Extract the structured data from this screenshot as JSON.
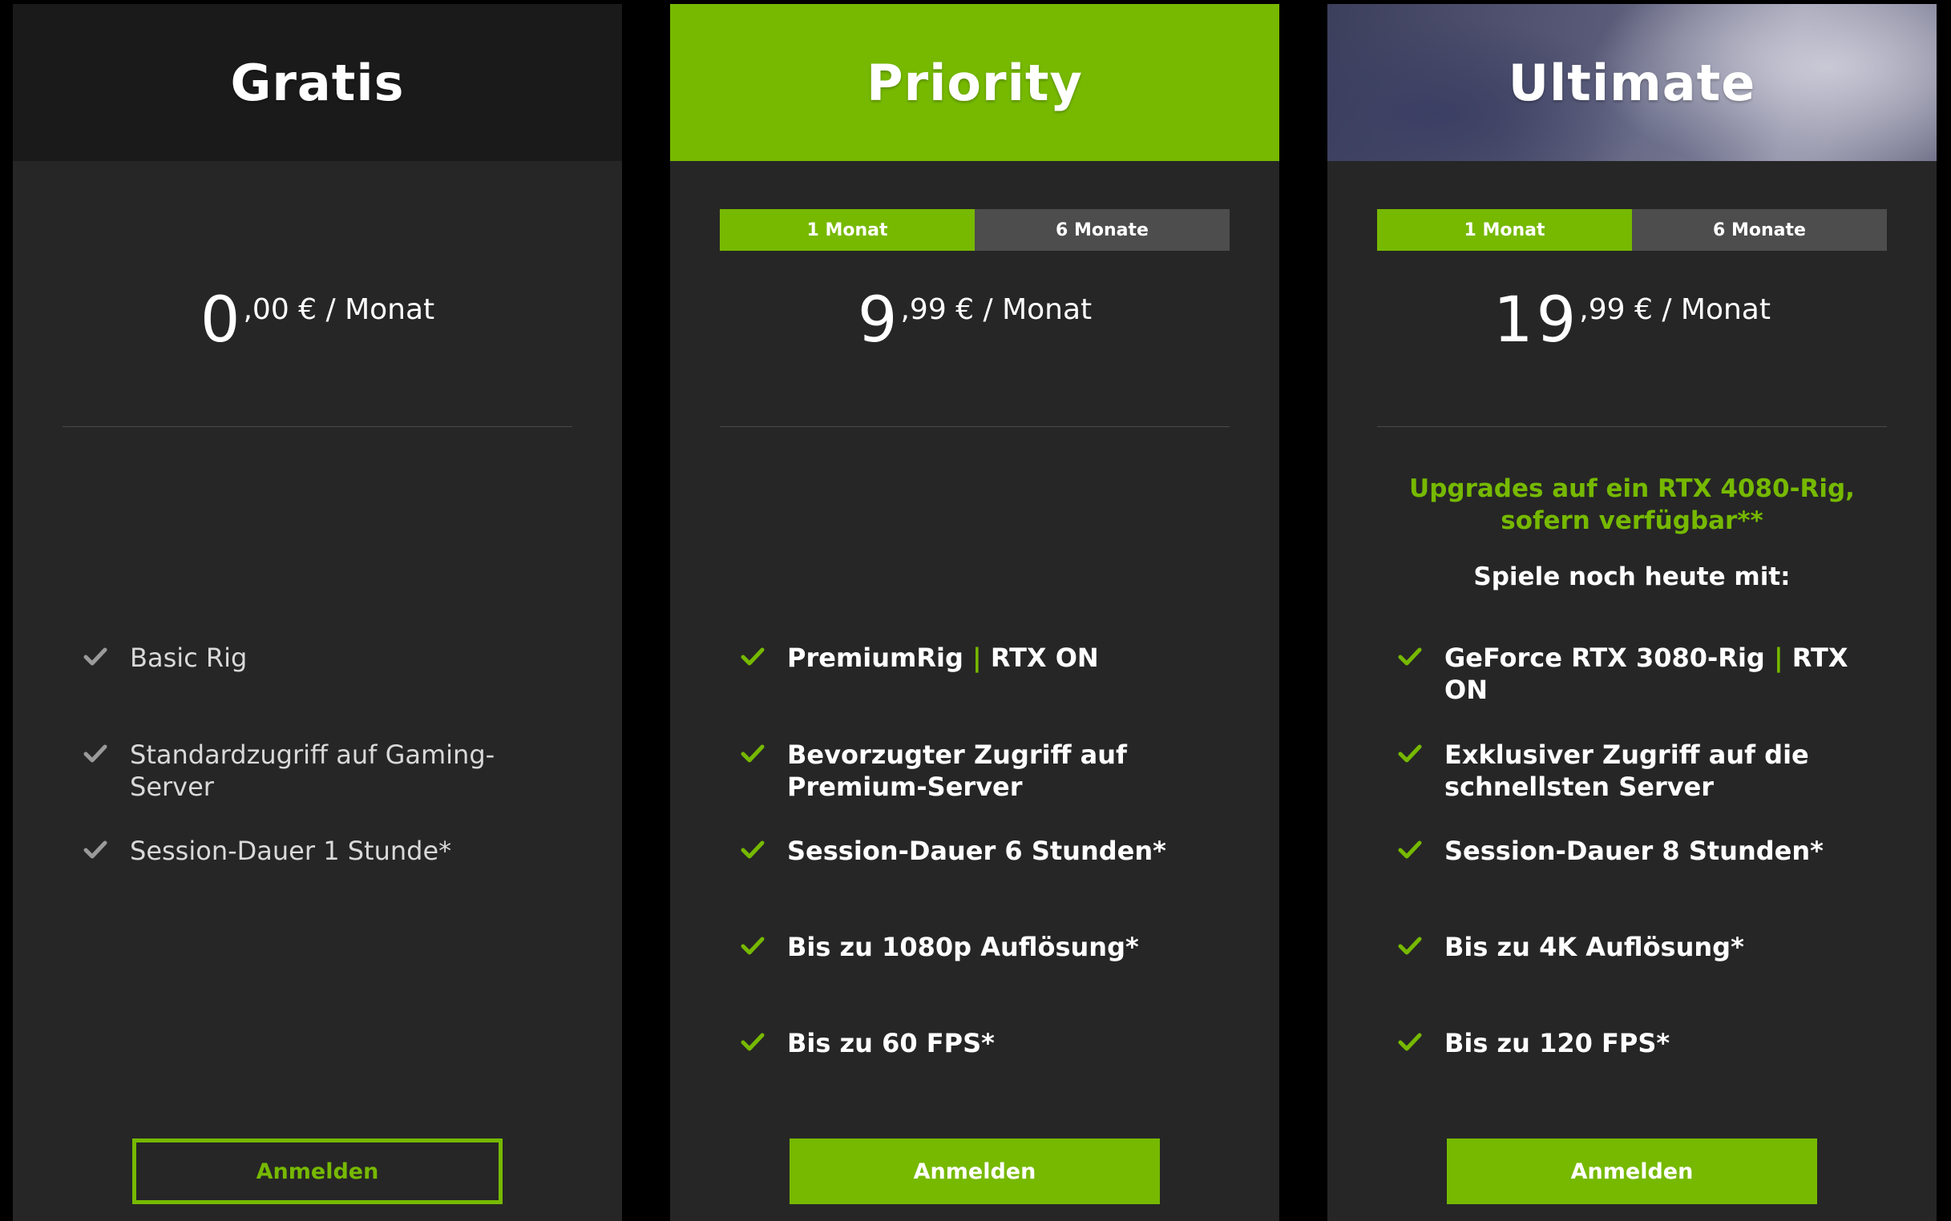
{
  "colors": {
    "accent": "#76b900",
    "card": "#262626",
    "background": "#000000"
  },
  "plans": [
    {
      "title": "Gratis",
      "toggle": null,
      "price": {
        "int": "0",
        "rest": ",00 € / Monat"
      },
      "highlight": "",
      "subhead": "",
      "features": [
        {
          "text": "Basic Rig"
        },
        {
          "text": "Standardzugriff auf Gaming-Server"
        },
        {
          "text": "Session-Dauer 1 Stunde*"
        }
      ],
      "cta": "Anmelden"
    },
    {
      "title": "Priority",
      "toggle": [
        "1 Monat",
        "6 Monate"
      ],
      "price": {
        "int": "9",
        "rest": ",99 € / Monat"
      },
      "highlight": "",
      "subhead": "",
      "features": [
        {
          "a": "PremiumRig",
          "b": "RTX ON"
        },
        {
          "text": "Bevorzugter Zugriff auf Premium-Server"
        },
        {
          "text": "Session-Dauer 6 Stunden*"
        },
        {
          "text": "Bis zu 1080p Auflösung*"
        },
        {
          "text": "Bis zu 60 FPS*"
        }
      ],
      "cta": "Anmelden"
    },
    {
      "title": "Ultimate",
      "toggle": [
        "1 Monat",
        "6 Monate"
      ],
      "price": {
        "int": "19",
        "rest": ",99 € / Monat"
      },
      "highlight": "Upgrades auf ein RTX 4080-Rig, sofern verfügbar**",
      "subhead": "Spiele noch heute mit:",
      "features": [
        {
          "a": "GeForce RTX 3080-Rig",
          "b": "RTX ON"
        },
        {
          "text": "Exklusiver Zugriff auf die schnellsten Server"
        },
        {
          "text": "Session-Dauer 8 Stunden*"
        },
        {
          "text": "Bis zu 4K Auflösung*"
        },
        {
          "text": "Bis zu 120 FPS*"
        }
      ],
      "cta": "Anmelden"
    }
  ],
  "icons": {
    "feature": "check-icon"
  }
}
